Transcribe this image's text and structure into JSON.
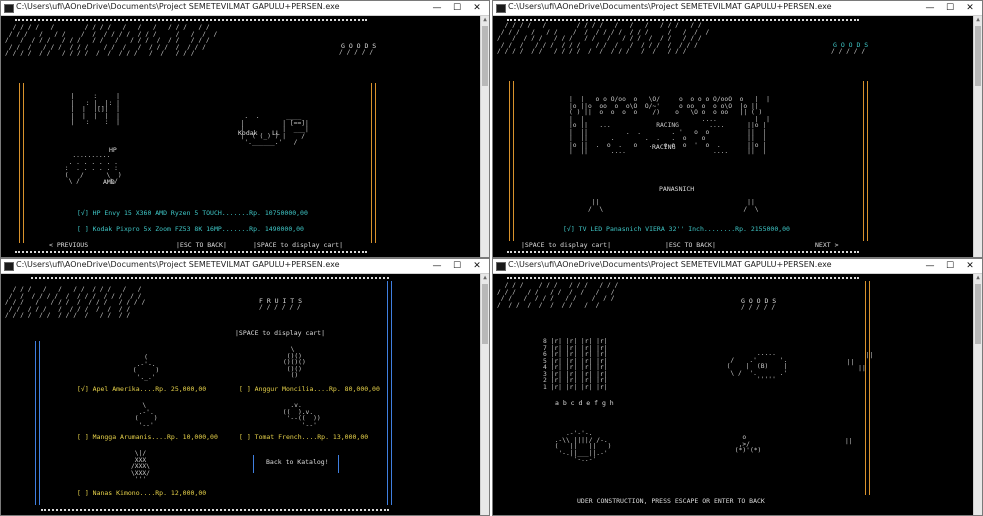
{
  "colors": {
    "orange": "#d8922c",
    "cyan": "#3fc7c7",
    "blue": "#3f7fe0",
    "yellow": "#e7d24a",
    "white": "#dcdcdc"
  },
  "window_controls": {
    "minimize": "—",
    "maximize": "☐",
    "close": "✕"
  },
  "win1": {
    "title": "C:\\Users\\ufi\\AOneDrive\\Documents\\Project SEMETEVILMAT GAPULU+PERSEN.exe",
    "goods": "G O O D S",
    "item1_label": "HP",
    "item1_sub": "AMD",
    "item2_label": "Kodak",
    "item2_sub": "LL",
    "row1": "[√] HP Envy 15 X360 AMD Ryzen 5 TOUCH.......Rp. 10750000,00",
    "row2": "[ ] Kodak Pixpro 5x Zoom FZ53 8K 16MP.......Rp. 1490000,00",
    "nav_prev": "< PREVIOUS",
    "nav_esc": "|ESC TO BACK|",
    "nav_space": "|SPACE to display cart|"
  },
  "win2": {
    "title": "C:\\Users\\ufi\\AOneDrive\\Documents\\Project SEMETEVILMAT GAPULU+PERSEN.exe",
    "goods": "G O O D S",
    "tv_racing": "RACING",
    "tv_brand": "PANASNICH",
    "row1": "[√] TV LED Panasnich VIERA 32'' Inch........Rp. 2155000,00",
    "nav_space": "|SPACE to display cart|",
    "nav_esc": "|ESC TO BACK|",
    "nav_next": "NEXT >"
  },
  "win3": {
    "title": "C:\\Users\\ufi\\AOneDrive\\Documents\\Project SEMETEVILMAT GAPULU+PERSEN.exe",
    "fruits": "F R U I T S",
    "space_cart": "|SPACE to display cart|",
    "apel": "[√] Apel Amerika....Rp. 25,000,00",
    "anggur": "[ ] Anggur Moncilia....Rp. 80,000,00",
    "mangga": "[ ] Mangga Arumanis....Rp. 10,000,00",
    "tomat": "[ ] Tomat French....Rp. 13,000,00",
    "nanas": "[ ] Nanas Kimono....Rp. 12,000,00",
    "back_katalog": "Back to Katalog!"
  },
  "win4": {
    "title": "C:\\Users\\ufi\\AOneDrive\\Documents\\Project SEMETEVILMAT GAPULU+PERSEN.exe",
    "goods": "G O O D S",
    "board_files": "a b c d e f g h",
    "board_ranks": [
      "8",
      "7",
      "6",
      "5",
      "4",
      "3",
      "2",
      "1"
    ],
    "construction": "UDER CONSTRUCTION, PRESS ESCAPE OR ENTER TO BACK"
  }
}
